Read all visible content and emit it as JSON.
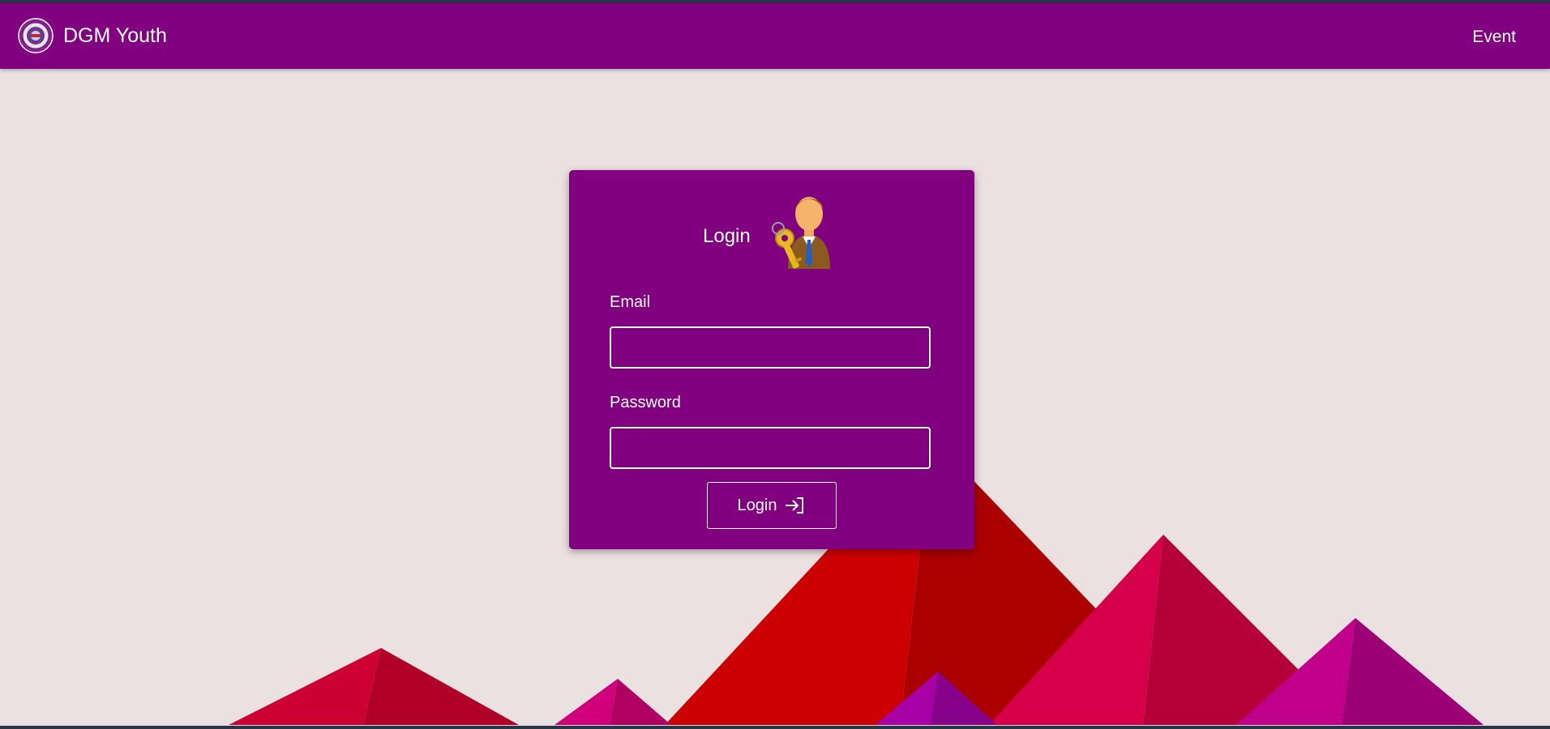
{
  "navbar": {
    "brand_name": "DGM Youth",
    "logo_icon": "circular-seal-logo-icon",
    "links": [
      {
        "label": "Event"
      }
    ],
    "background": "#800080"
  },
  "login_card": {
    "title": "Login",
    "illustration": "user-with-key-icon",
    "email": {
      "label": "Email",
      "value": "",
      "placeholder": ""
    },
    "password": {
      "label": "Password",
      "value": "",
      "placeholder": ""
    },
    "submit_label": "Login",
    "submit_icon": "sign-in-arrow-icon",
    "background": "#800080"
  },
  "colors": {
    "page_background": "#ebe1e1",
    "accent": "#800080",
    "mountain_red": "#cc0000",
    "mountain_crimson": "#d6004a",
    "mountain_magenta": "#c0008a"
  }
}
